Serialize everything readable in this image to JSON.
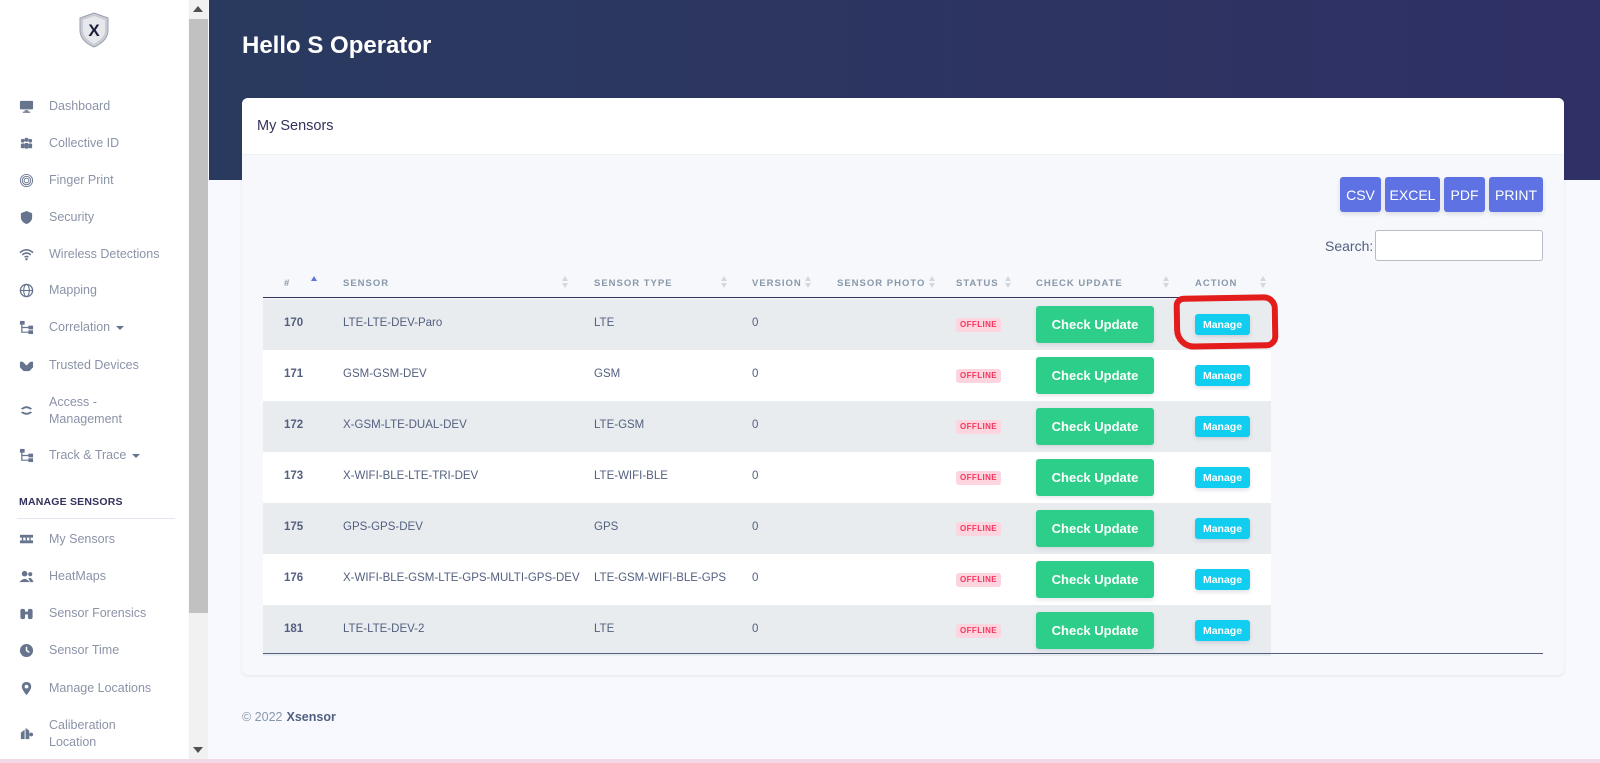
{
  "sidebar": {
    "items": [
      {
        "label": "Dashboard",
        "icon": "monitor-icon"
      },
      {
        "label": "Collective ID",
        "icon": "users-icon"
      },
      {
        "label": "Finger Print",
        "icon": "fingerprint-icon"
      },
      {
        "label": "Security",
        "icon": "shield-icon"
      },
      {
        "label": "Wireless Detections",
        "icon": "wifi-icon"
      },
      {
        "label": "Mapping",
        "icon": "globe-icon"
      },
      {
        "label": "Correlation",
        "icon": "sitemap-icon"
      },
      {
        "label": "Trusted Devices",
        "icon": "handshake-icon"
      },
      {
        "label": "Access -",
        "label2": "Management",
        "icon": "access-icon"
      },
      {
        "label": "Track & Trace",
        "icon": "sitemap-icon"
      }
    ],
    "section_title": "MANAGE SENSORS",
    "sensor_items": [
      {
        "label": "My Sensors",
        "icon": "sensors-icon"
      },
      {
        "label": "HeatMaps",
        "icon": "users-icon"
      },
      {
        "label": "Sensor Forensics",
        "icon": "binoculars-icon"
      },
      {
        "label": "Sensor Time",
        "icon": "clock-icon"
      },
      {
        "label": "Manage Locations",
        "icon": "map-pin-icon"
      },
      {
        "label": "Caliberation",
        "label2": "Location",
        "icon": "calibration-icon"
      }
    ]
  },
  "header": {
    "greeting": "Hello S Operator"
  },
  "card": {
    "title": "My Sensors"
  },
  "export": {
    "csv": "CSV",
    "excel": "EXCEL",
    "pdf": "PDF",
    "print": "PRINT"
  },
  "search": {
    "label": "Search:",
    "value": ""
  },
  "table": {
    "headers": [
      "#",
      "SENSOR",
      "SENSOR TYPE",
      "VERSION",
      "SENSOR PHOTO",
      "STATUS",
      "CHECK UPDATE",
      "ACTION"
    ],
    "rows": [
      {
        "id": "170",
        "sensor": "LTE-LTE-DEV-Paro",
        "type": "LTE",
        "version": "0",
        "status": "OFFLINE",
        "check": "Check Update",
        "action": "Manage"
      },
      {
        "id": "171",
        "sensor": "GSM-GSM-DEV",
        "type": "GSM",
        "version": "0",
        "status": "OFFLINE",
        "check": "Check Update",
        "action": "Manage"
      },
      {
        "id": "172",
        "sensor": "X-GSM-LTE-DUAL-DEV",
        "type": "LTE-GSM",
        "version": "0",
        "status": "OFFLINE",
        "check": "Check Update",
        "action": "Manage"
      },
      {
        "id": "173",
        "sensor": "X-WIFI-BLE-LTE-TRI-DEV",
        "type": "LTE-WIFI-BLE",
        "version": "0",
        "status": "OFFLINE",
        "check": "Check Update",
        "action": "Manage"
      },
      {
        "id": "175",
        "sensor": "GPS-GPS-DEV",
        "type": "GPS",
        "version": "0",
        "status": "OFFLINE",
        "check": "Check Update",
        "action": "Manage"
      },
      {
        "id": "176",
        "sensor": "X-WIFI-BLE-GSM-LTE-GPS-MULTI-GPS-DEV",
        "type": "LTE-GSM-WIFI-BLE-GPS",
        "version": "0",
        "status": "OFFLINE",
        "check": "Check Update",
        "action": "Manage"
      },
      {
        "id": "181",
        "sensor": "LTE-LTE-DEV-2",
        "type": "LTE",
        "version": "0",
        "status": "OFFLINE",
        "check": "Check Update",
        "action": "Manage"
      }
    ]
  },
  "footer": {
    "copyright": "© 2022",
    "brand": "Xsensor"
  },
  "colors": {
    "primary": "#5e72e4",
    "success": "#2dce89",
    "info": "#11cdef",
    "danger": "#f5365c",
    "header": "#2d3461",
    "highlight": "#e31c1c"
  }
}
